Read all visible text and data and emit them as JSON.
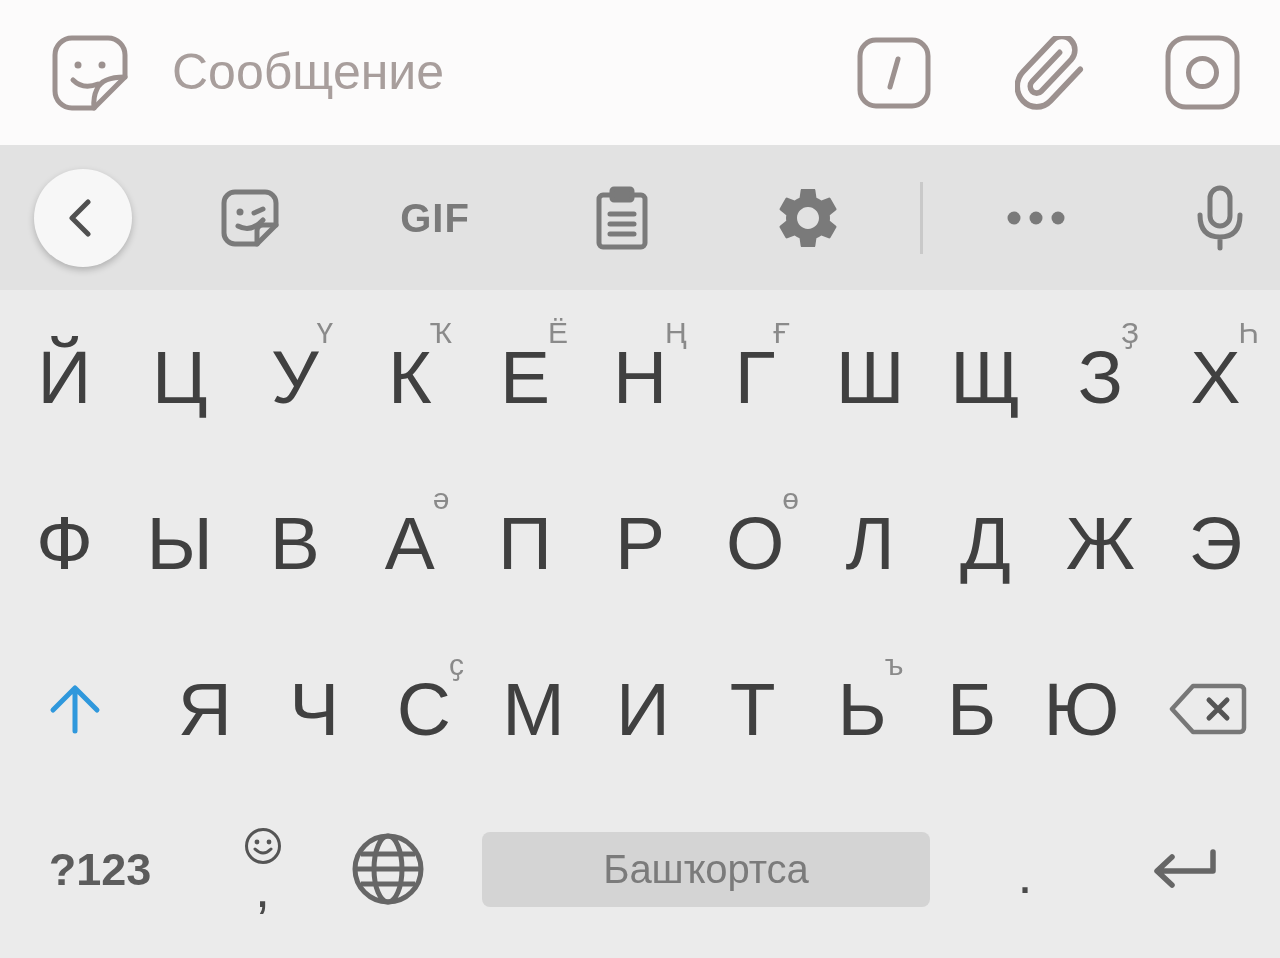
{
  "message_bar": {
    "placeholder": "Сообщение"
  },
  "toolbar": {
    "gif_label": "GIF"
  },
  "key_rows": [
    {
      "keys": [
        {
          "label": "Й"
        },
        {
          "label": "Ц"
        },
        {
          "label": "У",
          "hint": "Ү"
        },
        {
          "label": "К",
          "hint": "Ҡ"
        },
        {
          "label": "Е",
          "hint": "Ё"
        },
        {
          "label": "Н",
          "hint": "Ң"
        },
        {
          "label": "Г",
          "hint": "Ғ"
        },
        {
          "label": "Ш"
        },
        {
          "label": "Щ"
        },
        {
          "label": "З",
          "hint": "Ҙ"
        },
        {
          "label": "Х",
          "hint": "Һ"
        }
      ]
    },
    {
      "keys": [
        {
          "label": "Ф"
        },
        {
          "label": "Ы"
        },
        {
          "label": "В"
        },
        {
          "label": "А",
          "hint": "ә"
        },
        {
          "label": "П"
        },
        {
          "label": "Р"
        },
        {
          "label": "О",
          "hint": "ө"
        },
        {
          "label": "Л"
        },
        {
          "label": "Д"
        },
        {
          "label": "Ж"
        },
        {
          "label": "Э"
        }
      ]
    },
    {
      "keys": [
        {
          "label": "Я"
        },
        {
          "label": "Ч"
        },
        {
          "label": "С",
          "hint": "ҫ"
        },
        {
          "label": "М"
        },
        {
          "label": "И"
        },
        {
          "label": "Т"
        },
        {
          "label": "Ь",
          "hint": "ъ"
        },
        {
          "label": "Б"
        },
        {
          "label": "Ю"
        }
      ]
    }
  ],
  "shift_key": {
    "on": true
  },
  "bottom_row": {
    "symbols_label": "?123",
    "comma_label": ",",
    "space_label": "Башҡортса",
    "period_label": "."
  }
}
